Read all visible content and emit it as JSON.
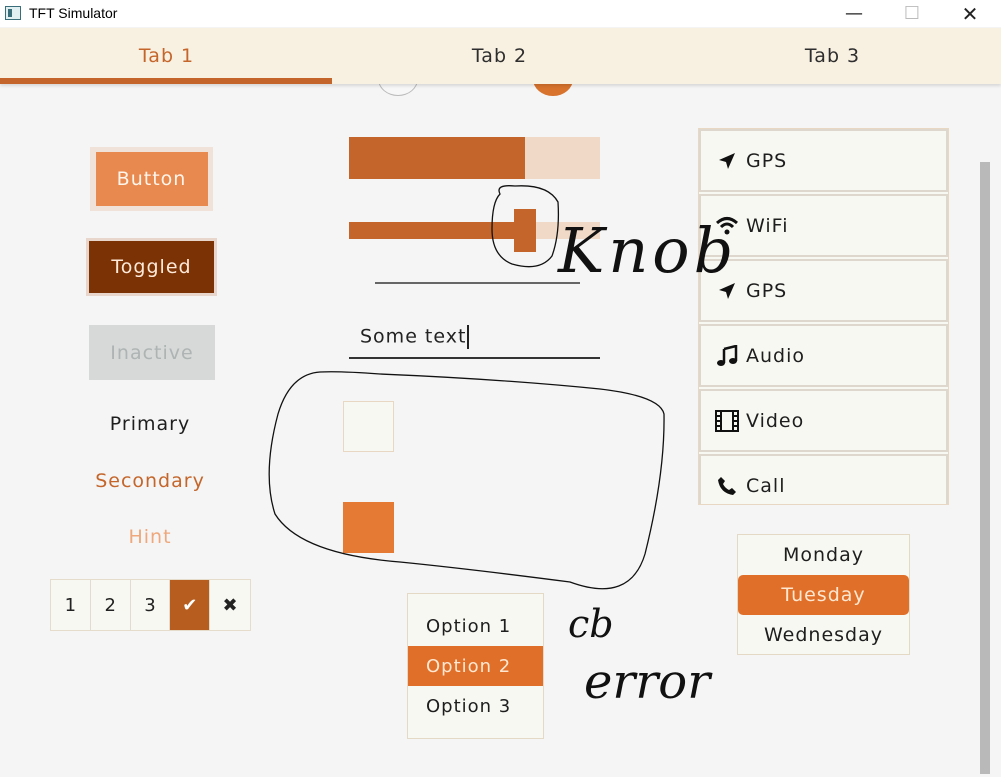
{
  "window": {
    "title": "TFT Simulator",
    "minimize_glyph": "—",
    "maximize_glyph": "☐",
    "close_glyph": "✕"
  },
  "tabs": [
    {
      "label": "Tab 1",
      "active": true
    },
    {
      "label": "Tab 2",
      "active": false
    },
    {
      "label": "Tab 3",
      "active": false
    }
  ],
  "buttons": {
    "button_label": "Button",
    "toggled_label": "Toggled",
    "inactive_label": "Inactive",
    "primary_label": "Primary",
    "secondary_label": "Secondary",
    "hint_label": "Hint"
  },
  "button_matrix": [
    "1",
    "2",
    "3",
    "✔",
    "✖"
  ],
  "bar": {
    "value_percent": 70
  },
  "slider": {
    "value_percent": 70
  },
  "textarea": {
    "value": "Some text"
  },
  "checkboxes": [
    {
      "checked": false
    },
    {
      "checked": true
    }
  ],
  "list": [
    {
      "icon": "gps-icon",
      "label": "GPS"
    },
    {
      "icon": "wifi-icon",
      "label": "WiFi"
    },
    {
      "icon": "gps-icon",
      "label": "GPS"
    },
    {
      "icon": "audio-icon",
      "label": "Audio"
    },
    {
      "icon": "video-icon",
      "label": "Video"
    },
    {
      "icon": "call-icon",
      "label": "Call"
    }
  ],
  "roller": {
    "options": [
      "Monday",
      "Tuesday",
      "Wednesday"
    ],
    "selected": "Tuesday"
  },
  "dropdown": {
    "options": [
      "Option 1",
      "Option 2",
      "Option 3"
    ],
    "selected": "Option 2"
  },
  "annotations": {
    "knob_note": "Knob",
    "cb_note": "cb",
    "error_note": "error"
  },
  "colors": {
    "accent": "#c4662b",
    "accent_light": "#e8894f",
    "toggled": "#7b3305",
    "tab_bar": "#f8f0e1",
    "background": "#f5f5f5"
  }
}
